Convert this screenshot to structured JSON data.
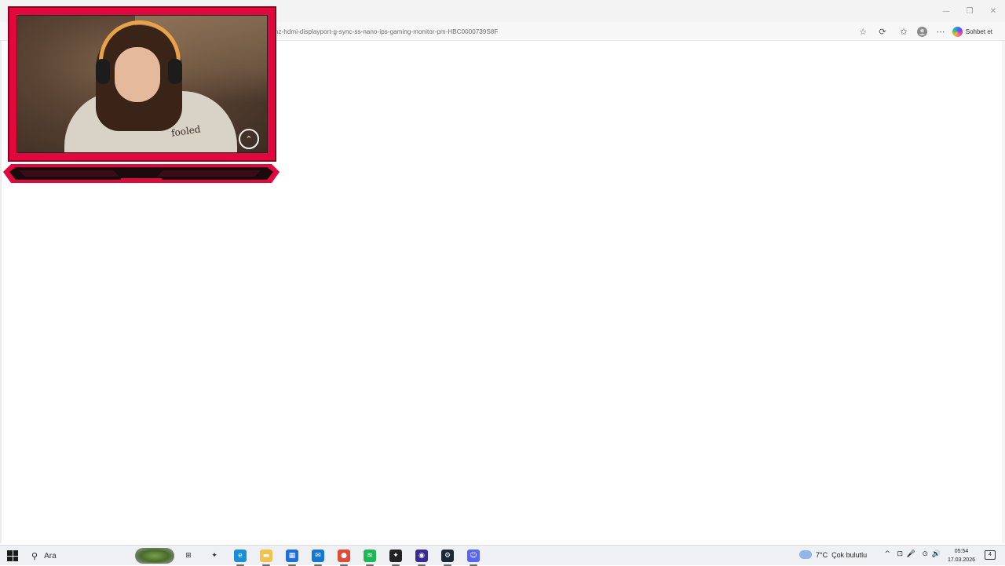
{
  "browser": {
    "url": "hz-hdmi-displayport-g-sync-ss-nano-ips-gaming-monitor-pm-HBC0000739S8F",
    "copilot_label": "Sohbet et",
    "icons": [
      "star-icon",
      "refresh-icon",
      "favorites-icon",
      "profile-icon",
      "more-icon"
    ]
  },
  "window_controls": {
    "minimize": "—",
    "restore": "❐",
    "close": "✕"
  },
  "webcam": {
    "hoodie_text": "fooled",
    "logo_glyph": "⌃"
  },
  "taskbar": {
    "search_label": "Ara",
    "apps": [
      {
        "name": "task-view",
        "glyph": "⊞",
        "color": "#ffffff"
      },
      {
        "name": "copilot",
        "glyph": "✦",
        "color": "#ffffff"
      },
      {
        "name": "edge",
        "glyph": "e",
        "color": "#1a8fd8"
      },
      {
        "name": "file-explorer",
        "glyph": "▬",
        "color": "#f2c14e"
      },
      {
        "name": "store",
        "glyph": "▦",
        "color": "#1e6fd9"
      },
      {
        "name": "mail",
        "glyph": "✉",
        "color": "#1677d2"
      },
      {
        "name": "chrome",
        "glyph": "●",
        "color": "#de4b39"
      },
      {
        "name": "spotify",
        "glyph": "≋",
        "color": "#1db954"
      },
      {
        "name": "app-red-black",
        "glyph": "✦",
        "color": "#222222"
      },
      {
        "name": "obs",
        "glyph": "◉",
        "color": "#3b2a8f"
      },
      {
        "name": "steam",
        "glyph": "⚙",
        "color": "#1b2838"
      },
      {
        "name": "discord",
        "glyph": "☺",
        "color": "#5865f2"
      }
    ],
    "weather": {
      "temp": "7°C",
      "desc": "Çok bulutlu"
    },
    "tray_icons": [
      "^",
      "⊡",
      "🎤",
      "⊙",
      "🔊"
    ],
    "clock": {
      "time": "05:54",
      "date": "17.03.2026"
    },
    "notification_count": "4"
  }
}
